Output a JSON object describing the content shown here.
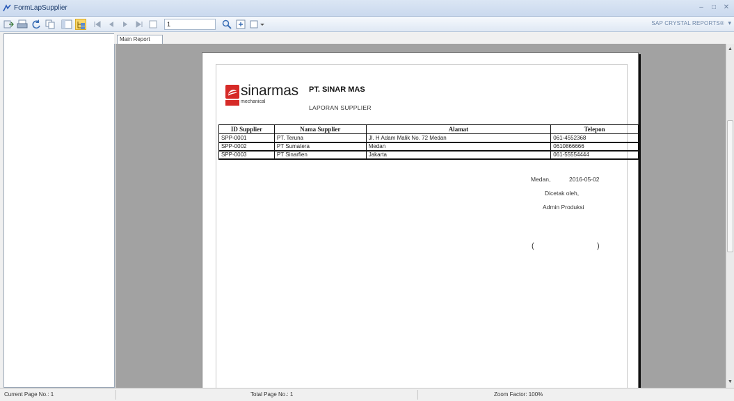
{
  "window": {
    "title": "FormLapSupplier",
    "minimize_icon": "minimize-icon",
    "maximize_icon": "maximize-icon",
    "close_icon": "close-icon"
  },
  "toolbar": {
    "icons": [
      "export-icon",
      "print-icon",
      "refresh-icon",
      "copy-icon",
      "toggle-tree-icon",
      "group-tree-icon",
      "first-page-icon",
      "prev-page-icon",
      "next-page-icon",
      "last-page-icon",
      "search-icon",
      "zoom-icon",
      "layout-icon"
    ],
    "page_value": "1",
    "brand": "SAP CRYSTAL REPORTS®"
  },
  "tab": {
    "label": "Main Report"
  },
  "report": {
    "logo_word": "sinarmas",
    "logo_sub": "mechanical",
    "company": "PT. SINAR MAS",
    "title": "LAPORAN SUPPLIER",
    "columns": [
      "ID Supplier",
      "Nama Supplier",
      "Alamat",
      "Telepon"
    ],
    "rows": [
      [
        "SPP-0001",
        "PT. Teruna",
        "Jl. H Adam Malik No. 72 Medan",
        "061-4552368"
      ],
      [
        "SPP-0002",
        "PT Sumatera",
        "Medan",
        "0610866666"
      ],
      [
        "SPP-0003",
        "PT Sinarfien",
        "Jakarta",
        "061-55554444"
      ]
    ],
    "place": "Medan,",
    "date": "2016-05-02",
    "printed_by": "Dicetak oleh,",
    "role": "Admin Produksi",
    "bracket_open": "(",
    "bracket_close": ")"
  },
  "status": {
    "current_page": "Current Page No.: 1",
    "total_page": "Total Page No.: 1",
    "zoom": "Zoom Factor: 100%"
  },
  "colors": {
    "accent": "#d62a27",
    "viewer_bg": "#a2a2a2",
    "titlebar": "#cad9ee"
  }
}
